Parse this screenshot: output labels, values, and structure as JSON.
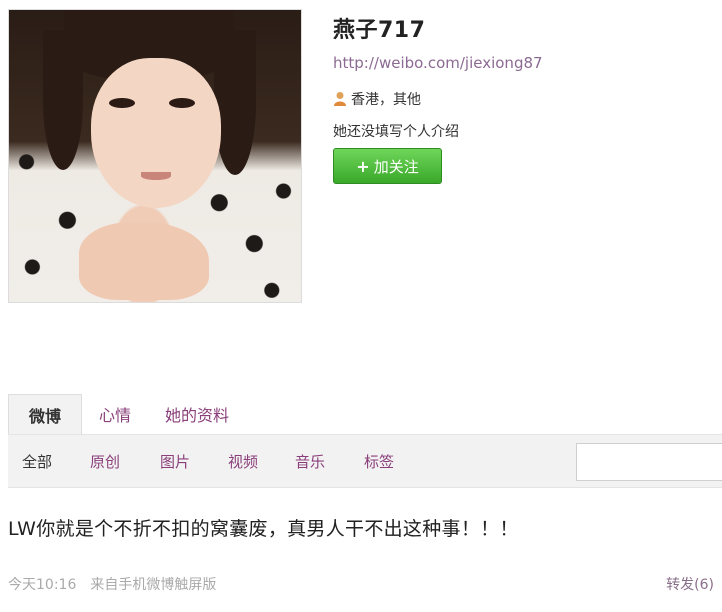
{
  "profile": {
    "name": "燕子717",
    "url": "http://weibo.com/jiexiong87",
    "location": "香港，其他",
    "bio": "她还没填写个人介绍",
    "follow_label": "加关注"
  },
  "tabs": [
    "微博",
    "心情",
    "她的资料"
  ],
  "filters": [
    "全部",
    "原创",
    "图片",
    "视频",
    "音乐",
    "标签"
  ],
  "post": {
    "text": "LW你就是个不折不扣的窝囊废，真男人干不出这种事！！！",
    "time": "今天10:16",
    "source": "来自手机微博触屏版",
    "repost": "转发(6)"
  },
  "colors": {
    "link": "#8a3f7a",
    "follow_button": "#4bbf3a"
  }
}
